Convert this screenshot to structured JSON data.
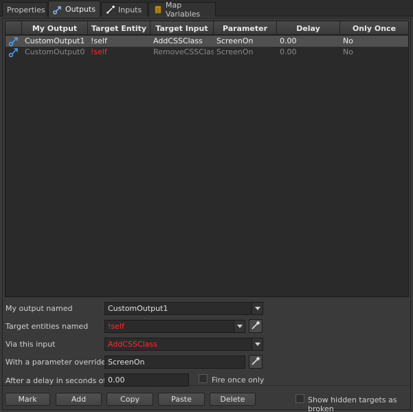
{
  "tabs": [
    {
      "label": "Properties",
      "icon": "none"
    },
    {
      "label": "Outputs",
      "icon": "outputs-icon"
    },
    {
      "label": "Inputs",
      "icon": "inputs-icon"
    },
    {
      "label": "Map Variables",
      "icon": "map-variables-icon"
    }
  ],
  "active_tab": "Outputs",
  "grid": {
    "columns": [
      "My Output",
      "Target Entity",
      "Target Input",
      "Parameter",
      "Delay",
      "Only Once"
    ],
    "rows": [
      {
        "my_output": "CustomOutput1",
        "target_entity": "!self",
        "target_input": "AddCSSClass",
        "parameter": "ScreenOn",
        "delay": "0.00",
        "only_once": "No",
        "selected": true
      },
      {
        "my_output": "CustomOutput0",
        "target_entity": "!self",
        "target_input": "RemoveCSSClass",
        "parameter": "ScreenOn",
        "delay": "0.00",
        "only_once": "No",
        "selected": false
      }
    ]
  },
  "form": {
    "output_label": "My output named",
    "output_value": "CustomOutput1",
    "target_label": "Target entities named",
    "target_value": "!self",
    "input_label": "Via this input",
    "input_value": "AddCSSClass",
    "param_label": "With a parameter override of",
    "param_value": "ScreenOn",
    "delay_label": "After a delay in seconds of",
    "delay_value": "0.00",
    "fire_once_label": "Fire once only"
  },
  "buttons": {
    "mark": "Mark",
    "add": "Add",
    "copy": "Copy",
    "paste": "Paste",
    "delete": "Delete",
    "show_hidden": "Show hidden targets as broken"
  },
  "colors": {
    "invalid_target": "#ff2a2a",
    "row_icon": "#4da3ff"
  }
}
